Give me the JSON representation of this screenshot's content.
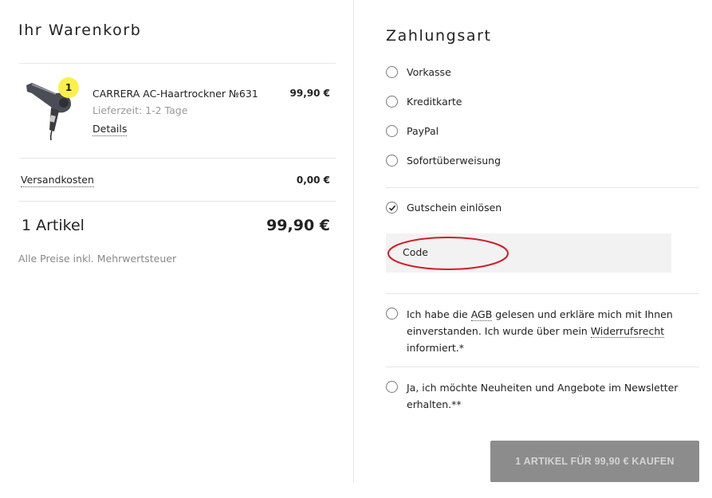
{
  "cart": {
    "title": "Ihr Warenkorb",
    "item": {
      "quantity": "1",
      "name": "CARRERA AC-Haartrockner №631",
      "price": "99,90 €",
      "delivery": "Lieferzeit: 1-2 Tage",
      "details_label": "Details",
      "image_icon": "hair-dryer-icon"
    },
    "shipping_label": "Versandkosten",
    "shipping_value": "0,00 €",
    "total_label": "1 Artikel",
    "total_value": "99,90 €",
    "vat_note": "Alle Preise inkl. Mehrwertsteuer"
  },
  "payment": {
    "title": "Zahlungsart",
    "options": [
      "Vorkasse",
      "Kreditkarte",
      "PayPal",
      "Sofortüberweisung"
    ],
    "voucher_label": "Gutschein einlösen",
    "voucher_checked": true,
    "code_placeholder": "Code",
    "annotation_color": "#d0202a"
  },
  "legal": {
    "terms_pre": "Ich habe die ",
    "terms_link_agb": "AGB",
    "terms_mid": " gelesen und erkläre mich mit Ihnen einverstanden. Ich wurde über mein ",
    "terms_link_widerruf": "Widerrufsrecht",
    "terms_post": " informiert.*",
    "newsletter": "Ja, ich möchte Neuheiten und Angebote im Newsletter erhalten.**"
  },
  "buy_button_label": "1 ARTIKEL FÜR 99,90 € KAUFEN",
  "colors": {
    "badge": "#fbf04a",
    "button_bg": "#8c8c8c",
    "button_text": "#d4d4d4"
  }
}
